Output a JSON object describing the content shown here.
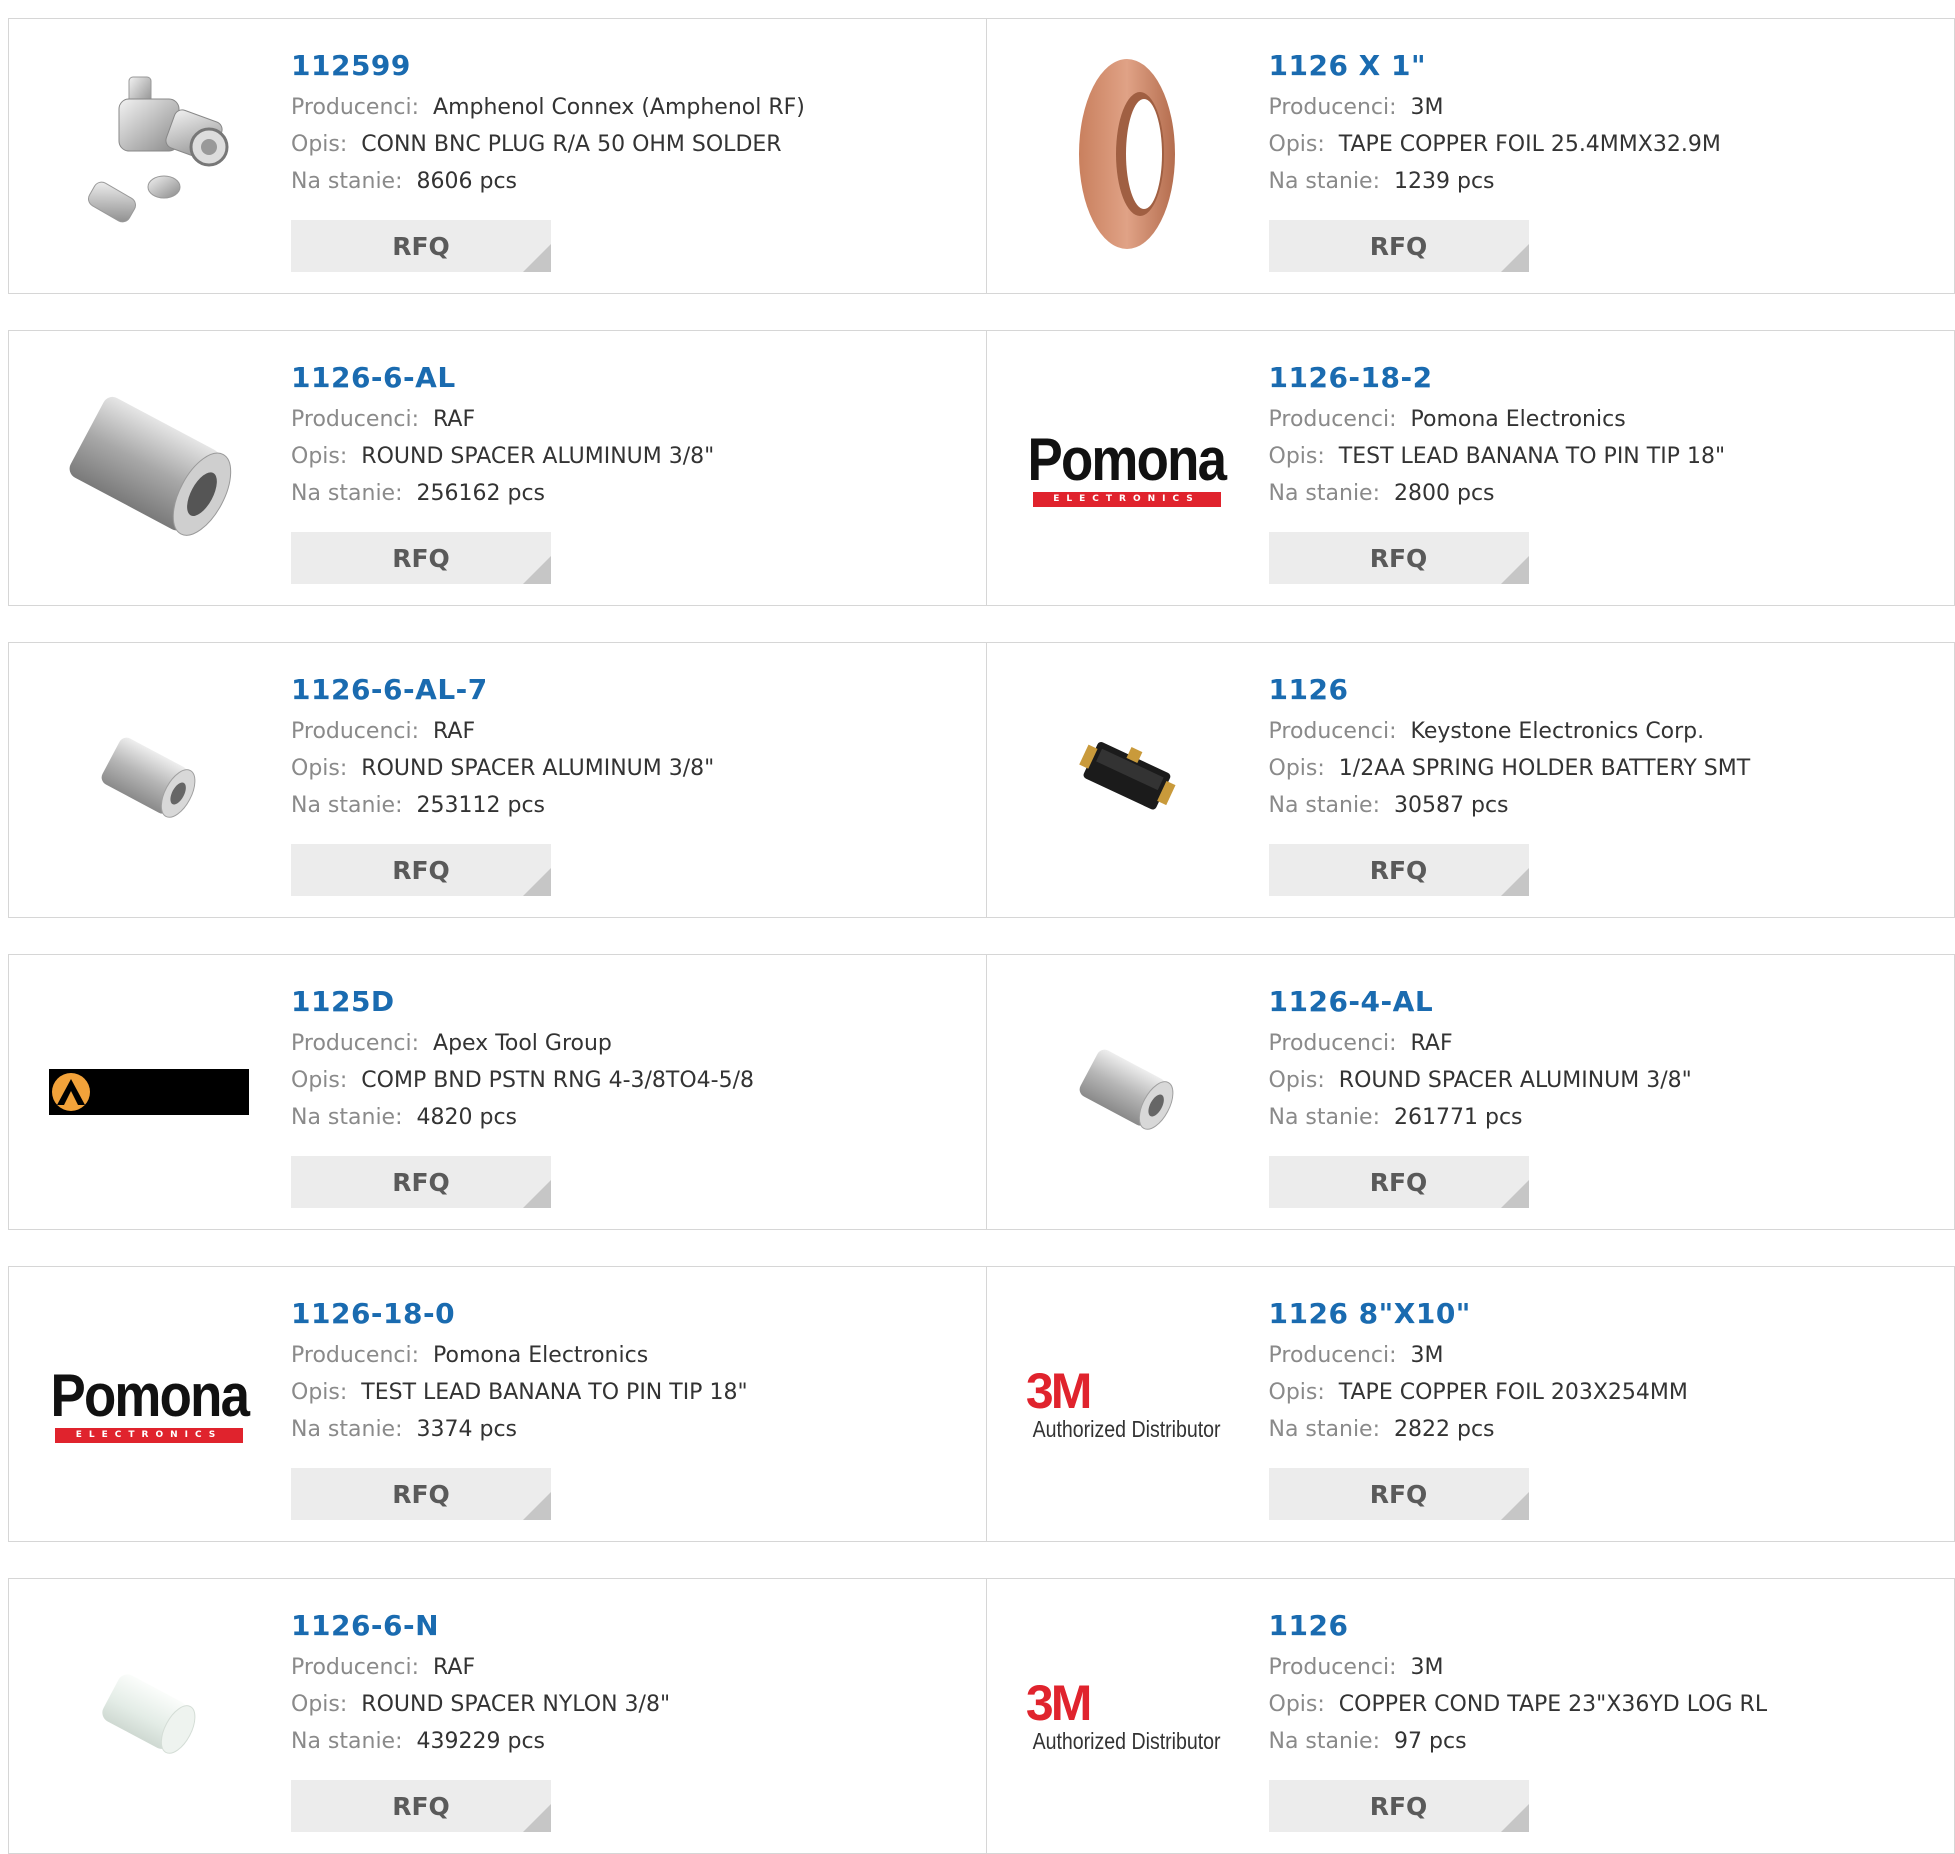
{
  "labels": {
    "manufacturer": "Producenci:",
    "description": "Opis:",
    "stock": "Na stanie:",
    "rfq": "RFQ"
  },
  "products": [
    {
      "part": "112599",
      "manufacturer": "Amphenol Connex (Amphenol RF)",
      "description": "CONN BNC PLUG R/A 50 OHM SOLDER",
      "stock": "8606 pcs",
      "image": "bnc-connector-icon"
    },
    {
      "part": "1126 X 1\"",
      "manufacturer": "3M",
      "description": "TAPE COPPER FOIL 25.4MMX32.9M",
      "stock": "1239 pcs",
      "image": "copper-tape-roll-icon"
    },
    {
      "part": "1126-6-AL",
      "manufacturer": "RAF",
      "description": "ROUND SPACER ALUMINUM 3/8\"",
      "stock": "256162 pcs",
      "image": "aluminum-spacer-icon"
    },
    {
      "part": "1126-18-2",
      "manufacturer": "Pomona Electronics",
      "description": "TEST LEAD BANANA TO PIN TIP 18\"",
      "stock": "2800 pcs",
      "image": "pomona-logo"
    },
    {
      "part": "1126-6-AL-7",
      "manufacturer": "RAF",
      "description": "ROUND SPACER ALUMINUM 3/8\"",
      "stock": "253112 pcs",
      "image": "aluminum-spacer-small-icon"
    },
    {
      "part": "1126",
      "manufacturer": "Keystone Electronics Corp.",
      "description": "1/2AA SPRING HOLDER BATTERY SMT",
      "stock": "30587 pcs",
      "image": "battery-holder-icon"
    },
    {
      "part": "1125D",
      "manufacturer": "Apex Tool Group",
      "description": "COMP BND PSTN RNG 4-3/8TO4-5/8",
      "stock": "4820 pcs",
      "image": "apex-logo"
    },
    {
      "part": "1126-4-AL",
      "manufacturer": "RAF",
      "description": "ROUND SPACER ALUMINUM 3/8\"",
      "stock": "261771 pcs",
      "image": "aluminum-spacer-small-icon"
    },
    {
      "part": "1126-18-0",
      "manufacturer": "Pomona Electronics",
      "description": "TEST LEAD BANANA TO PIN TIP 18\"",
      "stock": "3374 pcs",
      "image": "pomona-logo"
    },
    {
      "part": "1126 8\"X10\"",
      "manufacturer": "3M",
      "description": "TAPE COPPER FOIL 203X254MM",
      "stock": "2822 pcs",
      "image": "3m-logo"
    },
    {
      "part": "1126-6-N",
      "manufacturer": "RAF",
      "description": "ROUND SPACER NYLON 3/8\"",
      "stock": "439229 pcs",
      "image": "nylon-spacer-icon"
    },
    {
      "part": "1126",
      "manufacturer": "3M",
      "description": "COPPER COND TAPE 23\"X36YD LOG RL",
      "stock": "97 pcs",
      "image": "3m-logo"
    }
  ],
  "logos": {
    "pomona_word": "Pomona",
    "pomona_sub": "ELECTRONICS",
    "mmm_word": "3M",
    "mmm_sub": "Authorized Distributor"
  },
  "colors": {
    "part_link": "#1a6bb0",
    "label": "#8a8a8a",
    "button_bg": "#ececec",
    "brand_red": "#e0232d"
  }
}
